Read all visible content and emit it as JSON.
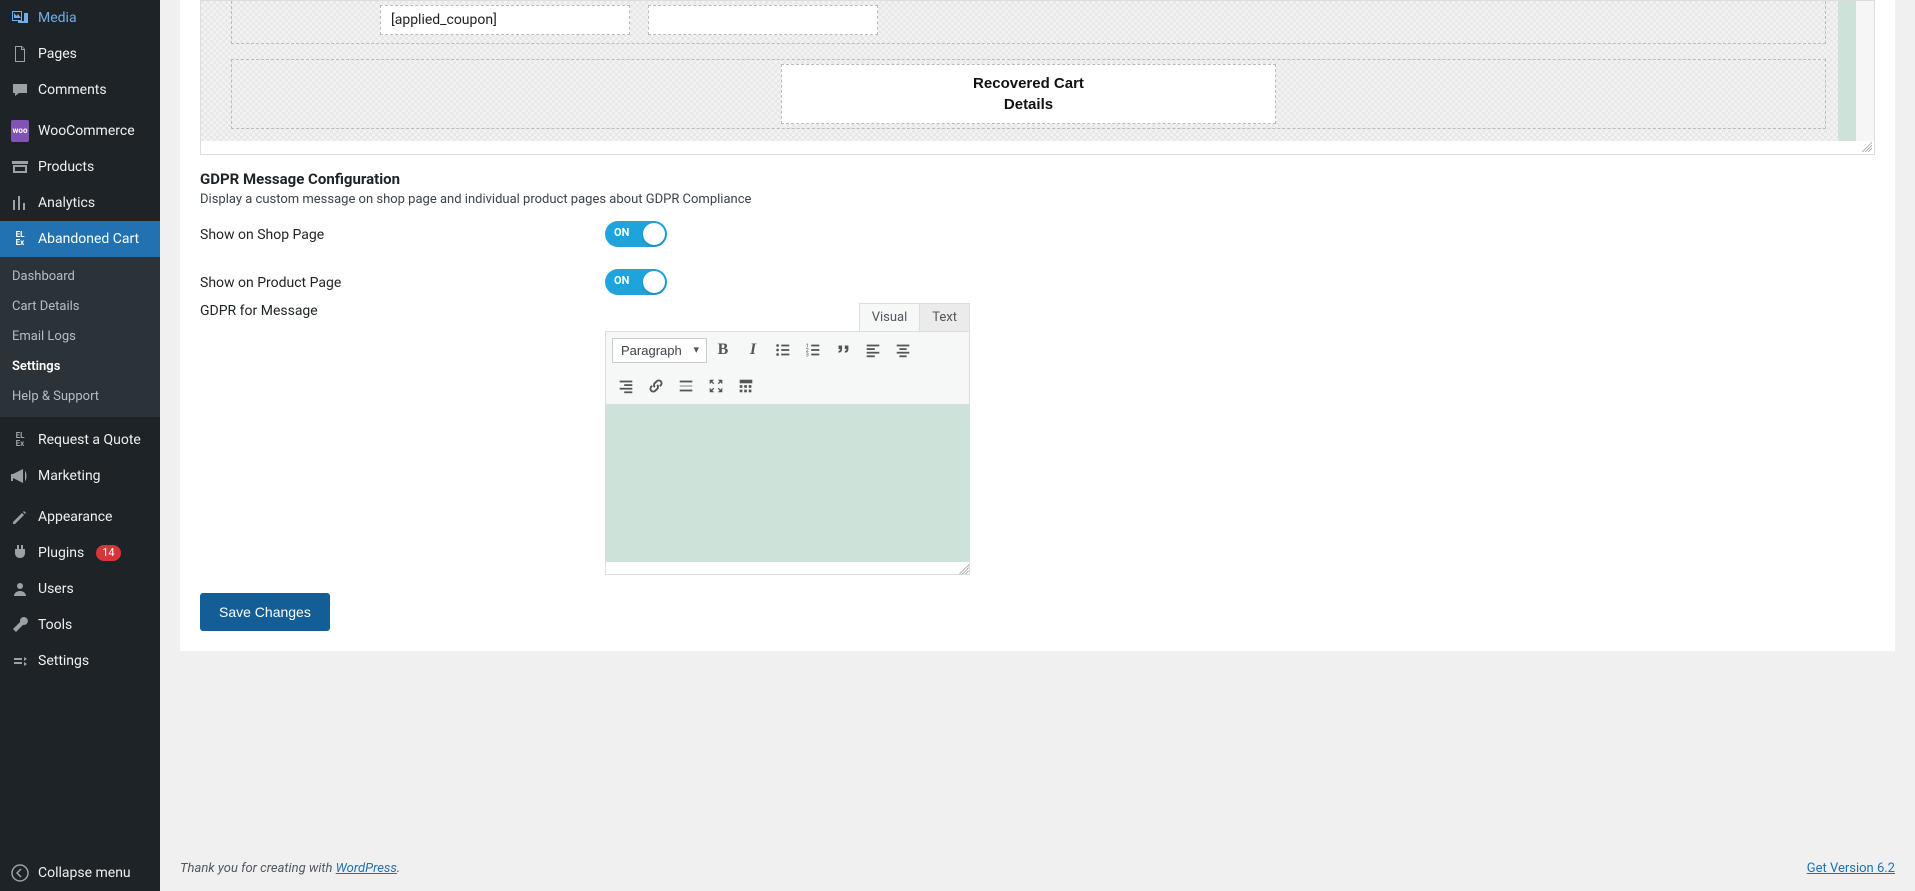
{
  "sidebar": {
    "media": "Media",
    "pages": "Pages",
    "comments": "Comments",
    "woocommerce": "WooCommerce",
    "products": "Products",
    "analytics": "Analytics",
    "abandoned_cart": "Abandoned Cart",
    "request_quote": "Request a Quote",
    "marketing": "Marketing",
    "appearance": "Appearance",
    "plugins": "Plugins",
    "plugins_badge": "14",
    "users": "Users",
    "tools": "Tools",
    "settings": "Settings",
    "collapse": "Collapse menu",
    "submenu": {
      "dashboard": "Dashboard",
      "cart_details": "Cart Details",
      "email_logs": "Email Logs",
      "settings": "Settings",
      "help_support": "Help & Support"
    }
  },
  "preview": {
    "applied_coupon_placeholder": "[applied_coupon]",
    "recovered_title_l1": "Recovered Cart",
    "recovered_title_l2": "Details"
  },
  "gdpr": {
    "heading": "GDPR Message Configuration",
    "desc": "Display a custom message on shop page and individual product pages about GDPR Compliance",
    "show_shop_label": "Show on Shop Page",
    "show_product_label": "Show on Product Page",
    "message_label": "GDPR for Message",
    "toggle_on": "ON"
  },
  "editor": {
    "tab_visual": "Visual",
    "tab_text": "Text",
    "paragraph": "Paragraph"
  },
  "save_button": "Save Changes",
  "footer": {
    "thankyou_prefix": "Thank you for creating with ",
    "wordpress": "WordPress",
    "period": ".",
    "version_link": "Get Version 6.2"
  }
}
